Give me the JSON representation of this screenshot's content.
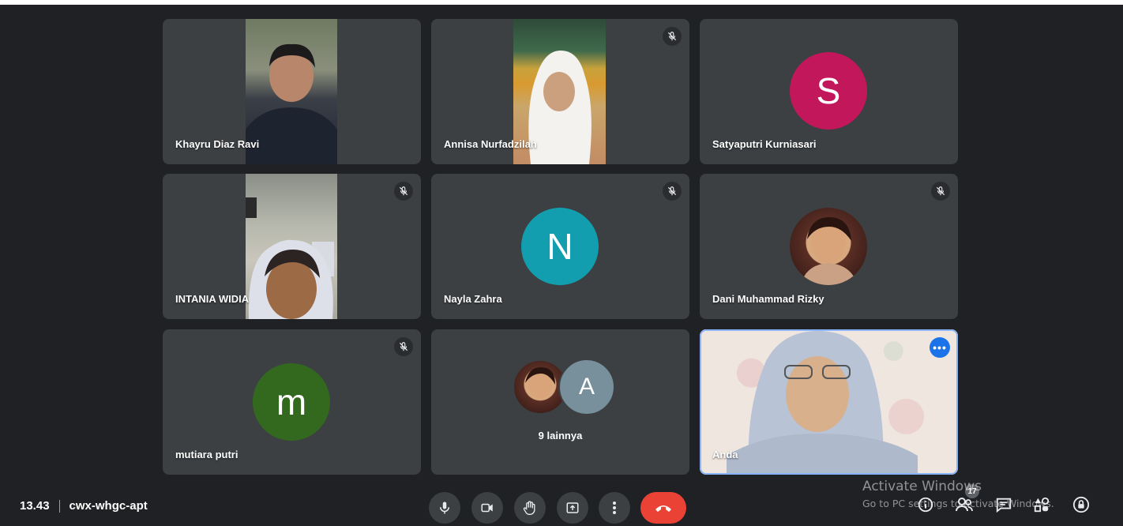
{
  "participants": [
    {
      "name": "Khayru Diaz Ravi",
      "muted": false,
      "type": "video"
    },
    {
      "name": "Annisa Nurfadzilah",
      "muted": true,
      "type": "video"
    },
    {
      "name": "Satyaputri Kurniasari",
      "muted": false,
      "type": "avatar",
      "initial": "S",
      "color": "#c2185b"
    },
    {
      "name": "INTANIA WIDIA",
      "muted": true,
      "type": "video"
    },
    {
      "name": "Nayla Zahra",
      "muted": true,
      "type": "avatar",
      "initial": "N",
      "color": "#129eaf"
    },
    {
      "name": "Dani Muhammad Rizky",
      "muted": true,
      "type": "photo-avatar"
    },
    {
      "name": "mutiara putri",
      "muted": true,
      "type": "avatar",
      "initial": "m",
      "color": "#33691e"
    }
  ],
  "others_tile": {
    "label": "9 lainnya",
    "avatar_initial": "A",
    "avatar_color": "#78909c"
  },
  "self_tile": {
    "name": "Anda",
    "menu_icon": "more-horiz-icon"
  },
  "meeting": {
    "time": "13.43",
    "code": "cwx-whgc-apt"
  },
  "controls": [
    {
      "name": "microphone-button",
      "icon": "mic-icon"
    },
    {
      "name": "camera-button",
      "icon": "videocam-icon"
    },
    {
      "name": "raise-hand-button",
      "icon": "hand-icon"
    },
    {
      "name": "present-button",
      "icon": "present-icon"
    },
    {
      "name": "more-options-button",
      "icon": "more-vert-icon"
    },
    {
      "name": "leave-call-button",
      "icon": "call-end-icon"
    }
  ],
  "right_panel": {
    "people_count": "17",
    "icons": [
      "info-icon",
      "people-icon",
      "chat-icon",
      "activities-icon",
      "host-controls-icon"
    ]
  },
  "watermark": {
    "title": "Activate Windows",
    "subtitle": "Go to PC settings to activate Windows."
  },
  "colors": {
    "background": "#202124",
    "tile": "#3c4043",
    "end_call": "#ea4335",
    "self_border": "#8ab4f8"
  }
}
